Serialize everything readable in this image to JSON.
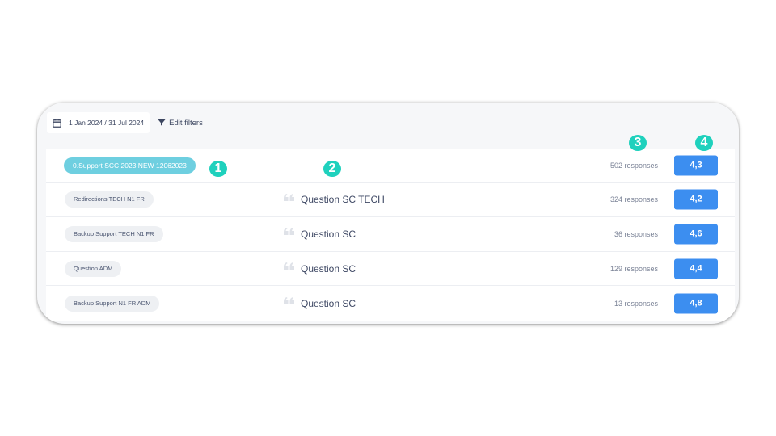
{
  "filters": {
    "date_range": "1 Jan 2024 / 31 Jul 2024",
    "edit_label": "Edit filters"
  },
  "rows": [
    {
      "tag": "0.Support SCC 2023 NEW 12062023",
      "question": "",
      "responses": "502 responses",
      "score": "4,3",
      "active": true
    },
    {
      "tag": "Redirections TECH N1 FR",
      "question": "Question SC TECH",
      "responses": "324 responses",
      "score": "4,2"
    },
    {
      "tag": "Backup Support TECH N1 FR",
      "question": "Question SC",
      "responses": "36 responses",
      "score": "4,6"
    },
    {
      "tag": "Question ADM",
      "question": "Question SC",
      "responses": "129 responses",
      "score": "4,4"
    },
    {
      "tag": "Backup Support N1 FR ADM",
      "question": "Question SC",
      "responses": "13 responses",
      "score": "4,8"
    }
  ],
  "markers": [
    "1",
    "2",
    "3",
    "4"
  ],
  "colors": {
    "active_tag": "#6ecfe0",
    "score_badge": "#3c8ef0",
    "marker": "#1fd1bd"
  },
  "icons": {
    "date": "calendar-icon",
    "filter": "funnel-icon",
    "question": "quote-icon"
  }
}
